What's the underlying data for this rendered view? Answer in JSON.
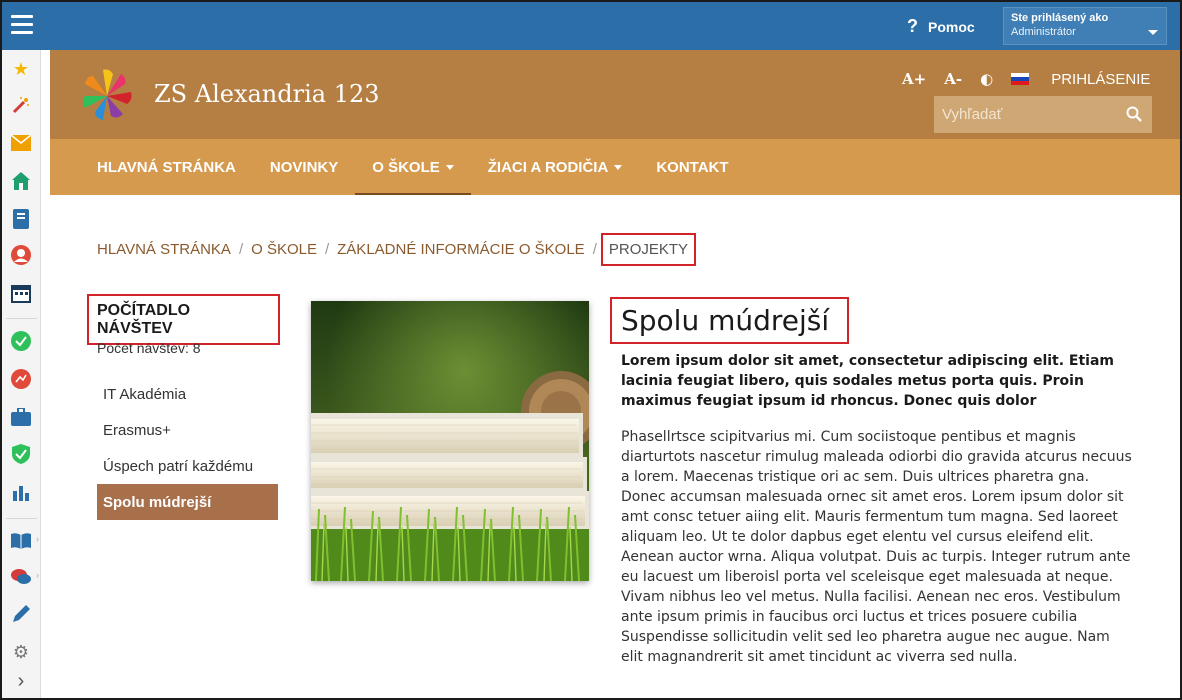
{
  "topbar": {
    "help_label": "Pomoc",
    "help_icon": "question-icon",
    "user_line1": "Ste prihlásený ako",
    "user_line2": "Administrátor"
  },
  "sidebar": {
    "icons": [
      "star-icon",
      "magic-wand-icon",
      "mail-icon",
      "home-icon",
      "notebook-icon",
      "user-icon",
      "calendar-icon",
      "check-circle-icon",
      "chart-circle-icon",
      "briefcase-icon",
      "shield-icon",
      "bar-chart-icon",
      "book-icon",
      "chat-icon",
      "pen-icon",
      "gear-icon",
      "chevron-right-icon"
    ]
  },
  "header": {
    "site_title": "ZS Alexandria 123",
    "font_increase": "A+",
    "font_decrease": "A-",
    "contrast_icon": "contrast-icon",
    "flag_icon": "slovak-flag-icon",
    "login_label": "PRIHLÁSENIE",
    "search_placeholder": "Vyhľadať"
  },
  "nav": {
    "items": [
      {
        "label": "HLAVNÁ STRÁNKA"
      },
      {
        "label": "NOVINKY"
      },
      {
        "label": "O ŠKOLE"
      },
      {
        "label": "ŽIACI A RODIČIA"
      },
      {
        "label": "KONTAKT"
      }
    ]
  },
  "breadcrumb": {
    "items": [
      "HLAVNÁ STRÁNKA",
      "O ŠKOLE",
      "ZÁKLADNÉ INFORMÁCIE O ŠKOLE"
    ],
    "separator": "/",
    "current": "PROJEKTY"
  },
  "counter": {
    "heading": "POČÍTADLO NÁVŠTEV",
    "value": "Počet návštev: 8"
  },
  "submenu": {
    "items": [
      {
        "label": "IT Akadémia"
      },
      {
        "label": "Erasmus+"
      },
      {
        "label": "Úspech patrí každému"
      },
      {
        "label": "Spolu múdrejší"
      }
    ]
  },
  "article": {
    "title": "Spolu múdrejší",
    "lead": "Lorem ipsum dolor sit amet, consectetur adipiscing elit. Etiam lacinia feugiat libero, quis sodales metus porta quis. Proin maximus feugiat ipsum id rhoncus. Donec quis dolor",
    "body": "Phasellrtsce scipitvarius mi. Cum sociistoque pentibus et magnis diarturtots nascetur rimulug maleada odiorbi dio gravida atcurus necuus a lorem. Maecenas tristique ori ac sem. Duis ultrices pharetra gna. Donec accumsan malesuada ornec sit amet eros. Lorem ipsum dolor sit amt consc tetuer aiing elit. Mauris fermentum tum magna. Sed laoreet aliquam leo. Ut te dolor dapbus eget elentu vel cursus eleifend elit. Aenean auctor wrna. Aliqua volutpat. Duis ac turpis. Integer rutrum ante eu lacuest um liberoisl porta vel sceleisque eget malesuada at neque. Vivam nibhus leo vel metus. Nulla facilisi. Aenean nec eros. Vestibulum ante ipsum primis in faucibus orci luctus et trices posuere cubilia Suspendisse sollicitudin velit sed leo pharetra augue nec augue. Nam elit magnandrerit sit amet tincidunt ac viverra sed nulla."
  }
}
